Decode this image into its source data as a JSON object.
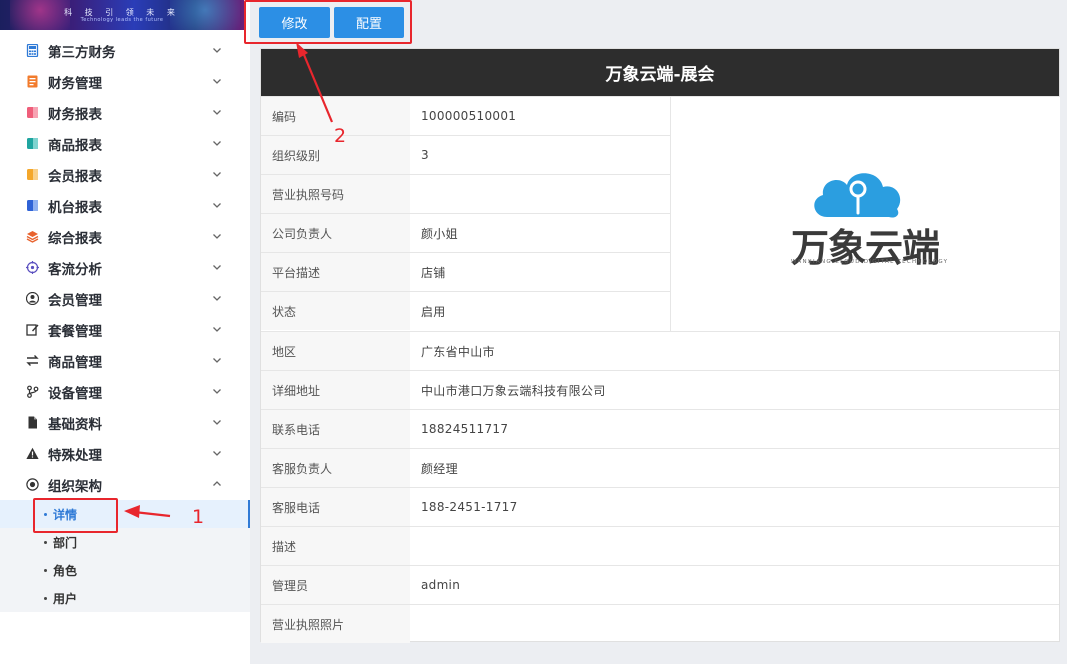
{
  "banner": {
    "line1": "科 技 引 领 未 来",
    "line2": "Technology leads the future"
  },
  "sidebar": {
    "items": [
      {
        "label": "第三方财务",
        "icon": "calculator-icon",
        "color": "#2f7ad6"
      },
      {
        "label": "财务管理",
        "icon": "ledger-icon",
        "color": "#f27b2c"
      },
      {
        "label": "财务报表",
        "icon": "report-icon",
        "color": "#ef5e7a"
      },
      {
        "label": "商品报表",
        "icon": "goods-report-icon",
        "color": "#1fa5a0"
      },
      {
        "label": "会员报表",
        "icon": "member-report-icon",
        "color": "#f4a72b"
      },
      {
        "label": "机台报表",
        "icon": "machine-report-icon",
        "color": "#2f62d6"
      },
      {
        "label": "综合报表",
        "icon": "layers-icon",
        "color": "#e8622d"
      },
      {
        "label": "客流分析",
        "icon": "target-icon",
        "color": "#5a4fbf"
      },
      {
        "label": "会员管理",
        "icon": "user-icon",
        "color": "#333333"
      },
      {
        "label": "套餐管理",
        "icon": "package-edit-icon",
        "color": "#333333"
      },
      {
        "label": "商品管理",
        "icon": "swap-icon",
        "color": "#333333"
      },
      {
        "label": "设备管理",
        "icon": "device-icon",
        "color": "#333333"
      },
      {
        "label": "基础资料",
        "icon": "file-icon",
        "color": "#333333"
      },
      {
        "label": "特殊处理",
        "icon": "warning-icon",
        "color": "#333333"
      },
      {
        "label": "组织架构",
        "icon": "radio-icon",
        "color": "#333333"
      }
    ],
    "subitems": [
      {
        "label": "详情",
        "active": true
      },
      {
        "label": "部门",
        "active": false
      },
      {
        "label": "角色",
        "active": false
      },
      {
        "label": "用户",
        "active": false
      }
    ]
  },
  "toolbar": {
    "edit_label": "修改",
    "config_label": "配置"
  },
  "annotations": {
    "num1": "1",
    "num2": "2"
  },
  "detail": {
    "title": "万象云端-展会",
    "logo_text": "万象云端",
    "logo_sub": "WANXIANG CLOUD DIGITAL TECHNOLOGY",
    "rows": [
      {
        "key": "编码",
        "value": "100000510001"
      },
      {
        "key": "组织级别",
        "value": "3"
      },
      {
        "key": "营业执照号码",
        "value": ""
      },
      {
        "key": "公司负责人",
        "value": "颜小姐"
      },
      {
        "key": "平台描述",
        "value": "店铺"
      },
      {
        "key": "状态",
        "value": "启用"
      },
      {
        "key": "地区",
        "value": "广东省中山市"
      },
      {
        "key": "详细地址",
        "value": "中山市港口万象云端科技有限公司"
      },
      {
        "key": "联系电话",
        "value": "18824511717"
      },
      {
        "key": "客服负责人",
        "value": "颜经理"
      },
      {
        "key": "客服电话",
        "value": "188-2451-1717"
      },
      {
        "key": "描述",
        "value": ""
      },
      {
        "key": "管理员",
        "value": "admin"
      },
      {
        "key": "营业执照照片",
        "value": ""
      }
    ]
  },
  "colors": {
    "accent": "#2c8fe5",
    "annotation": "#e8262d",
    "header": "#2d2d2d",
    "logo_blue": "#2b9ee0"
  }
}
